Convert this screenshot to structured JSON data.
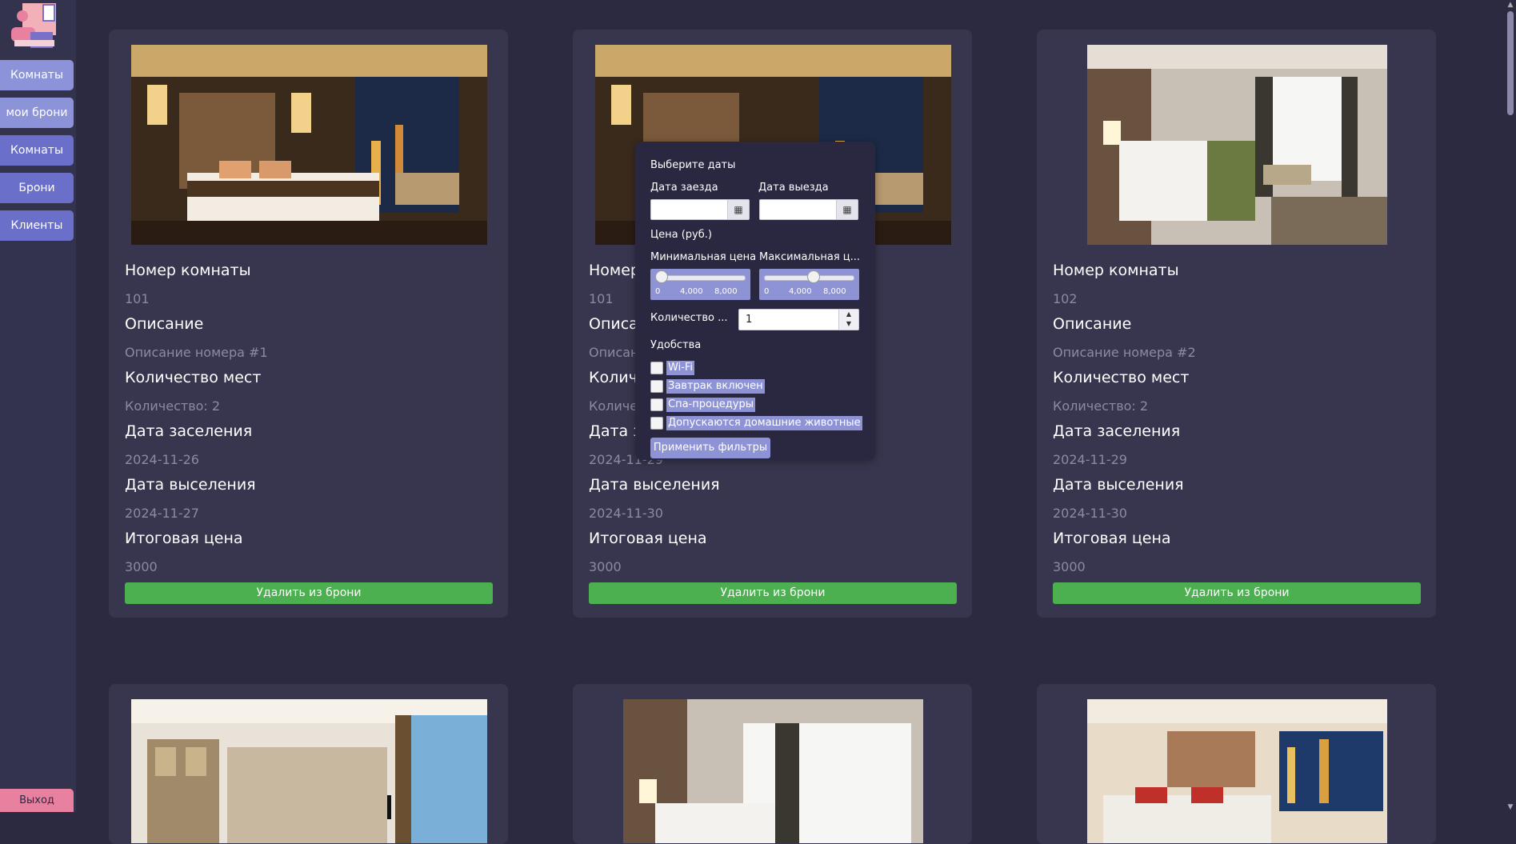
{
  "sidebar": {
    "items": [
      {
        "label": "Комнаты"
      },
      {
        "label": "мои брони"
      },
      {
        "label": "Комнаты"
      },
      {
        "label": "Брони"
      },
      {
        "label": "Клиенты"
      }
    ],
    "exit_label": "Выход"
  },
  "field_titles": {
    "room_number": "Номер комнаты",
    "description": "Описание",
    "seats": "Количество мест",
    "checkin": "Дата заселения",
    "checkout": "Дата выселения",
    "total": "Итоговая цена"
  },
  "cards": [
    {
      "room": "101",
      "description": "Описание номера #1",
      "seats": "Количество: 2",
      "checkin": "2024-11-26",
      "checkout": "2024-11-27",
      "total": "3000",
      "button": "Удалить из брони"
    },
    {
      "room": "101",
      "description": "Описан",
      "seats": "Количе",
      "checkin": "2024-11-29",
      "checkout": "2024-11-30",
      "total": "3000",
      "button": "Удалить из брони",
      "partial_titles": {
        "room_number": "Номер",
        "description": "Описан",
        "seats": "Количе",
        "checkin": "Дата за"
      }
    },
    {
      "room": "102",
      "description": "Описание номера #2",
      "seats": "Количество: 2",
      "checkin": "2024-11-29",
      "checkout": "2024-11-30",
      "total": "3000",
      "button": "Удалить из брони"
    }
  ],
  "filter": {
    "title": "Выберите даты",
    "checkin_label": "Дата заезда",
    "checkout_label": "Дата выезда",
    "price_label": "Цена (руб.)",
    "min_price_label": "Минимальная цена",
    "max_price_label": "Максимальная ц...",
    "min_price_value": 0,
    "max_price_value": 5500,
    "slider_max": 10000,
    "ticks": [
      "0",
      "4,000",
      "8,000"
    ],
    "guests_label": "Количество ...",
    "guests_value": "1",
    "amenities_label": "Удобства",
    "amenities": [
      {
        "label": "Wi-Fi",
        "checked": false
      },
      {
        "label": "Завтрак включен",
        "checked": false
      },
      {
        "label": "Спа-процедуры",
        "checked": false
      },
      {
        "label": "Допускаются домашние животные",
        "checked": false
      }
    ],
    "apply_label": "Применить фильтры"
  },
  "icons": {
    "calendar": "calendar-icon",
    "spinner_up": "chevron-up-icon",
    "spinner_down": "chevron-down-icon"
  },
  "colors": {
    "background": "#2b2a40",
    "card": "#38364f",
    "accent": "#8e93d6",
    "remove_button": "#4caf50",
    "exit_button": "#e8819f"
  }
}
